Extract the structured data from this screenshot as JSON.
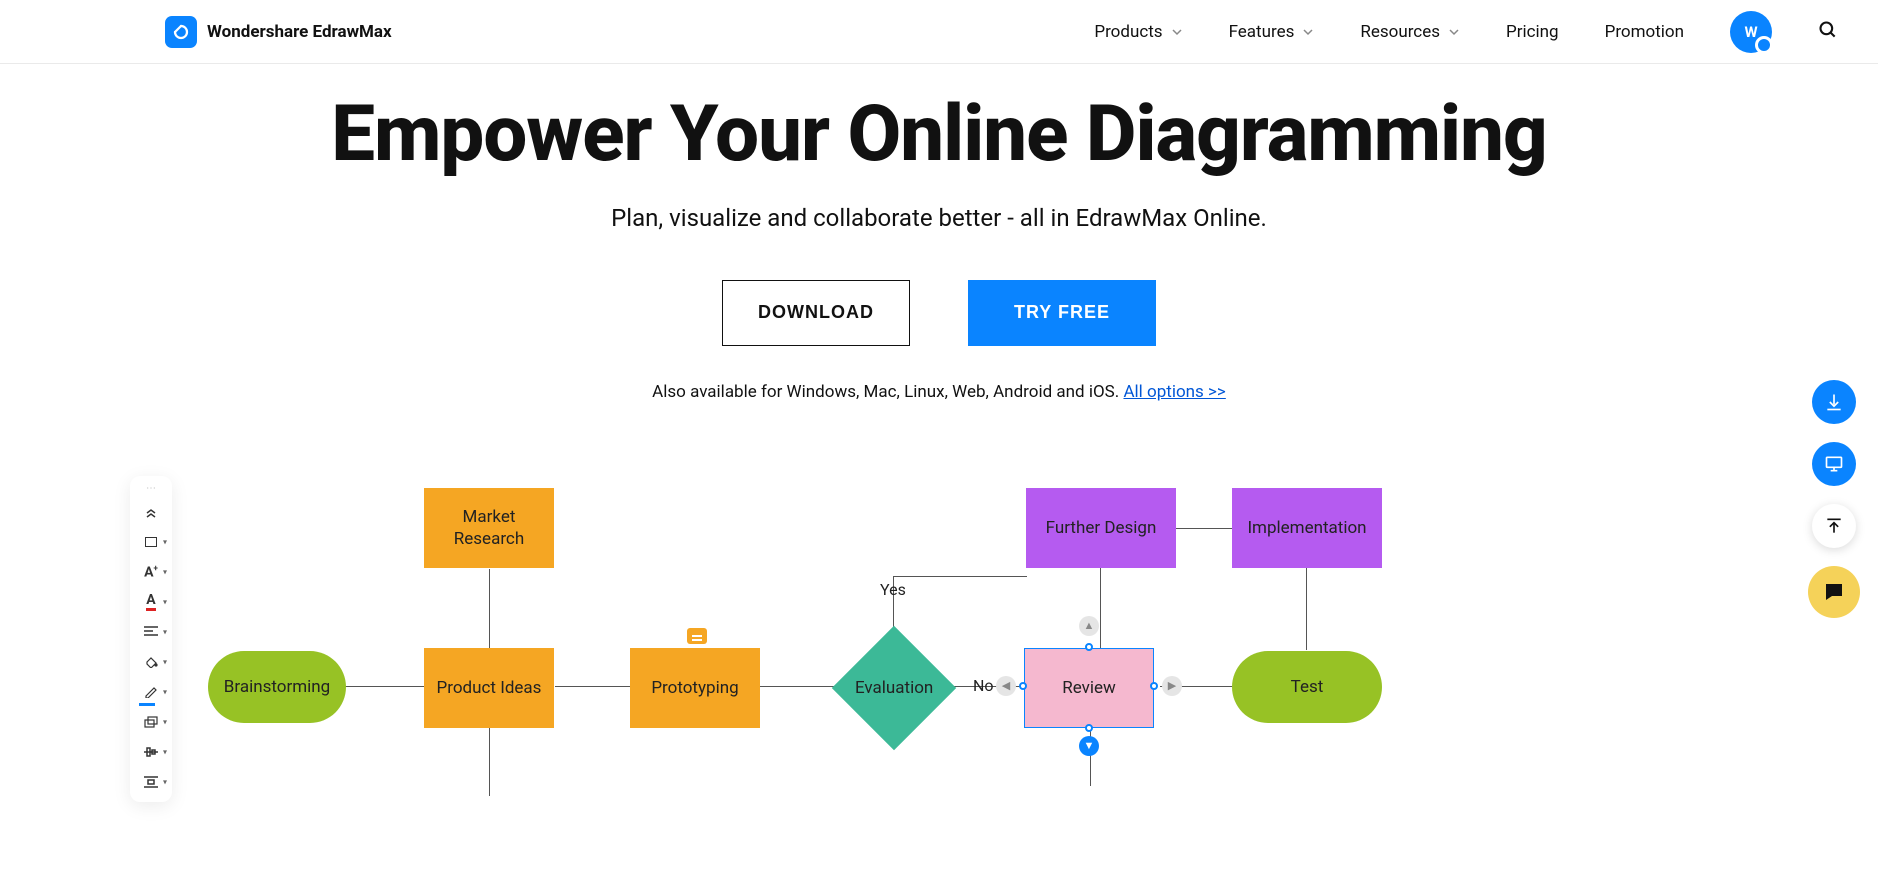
{
  "header": {
    "brand": "Wondershare EdrawMax",
    "nav": {
      "products": "Products",
      "features": "Features",
      "resources": "Resources",
      "pricing": "Pricing",
      "promotion": "Promotion"
    },
    "avatar_initial": "W"
  },
  "hero": {
    "title": "Empower Your Online Diagramming",
    "subtitle": "Plan, visualize and collaborate better - all in EdrawMax Online.",
    "download_label": "DOWNLOAD",
    "tryfree_label": "TRY FREE",
    "availability_prefix": "Also available for Windows, Mac, Linux, Web, Android and iOS. ",
    "availability_link": "All options >>"
  },
  "flow": {
    "brainstorming": "Brainstorming",
    "product_ideas": "Product Ideas",
    "market_research": "Market Research",
    "prototyping": "Prototyping",
    "evaluation": "Evaluation",
    "review": "Review",
    "test": "Test",
    "further_design": "Further Design",
    "implementation": "Implementation",
    "yes": "Yes",
    "no": "No"
  },
  "colors": {
    "primary": "#0a84ff",
    "green": "#97c225",
    "orange": "#f5a623",
    "purple": "#b55bf0",
    "teal": "#3cb997",
    "pink": "#f5b8cf",
    "yellow": "#f5d259"
  }
}
